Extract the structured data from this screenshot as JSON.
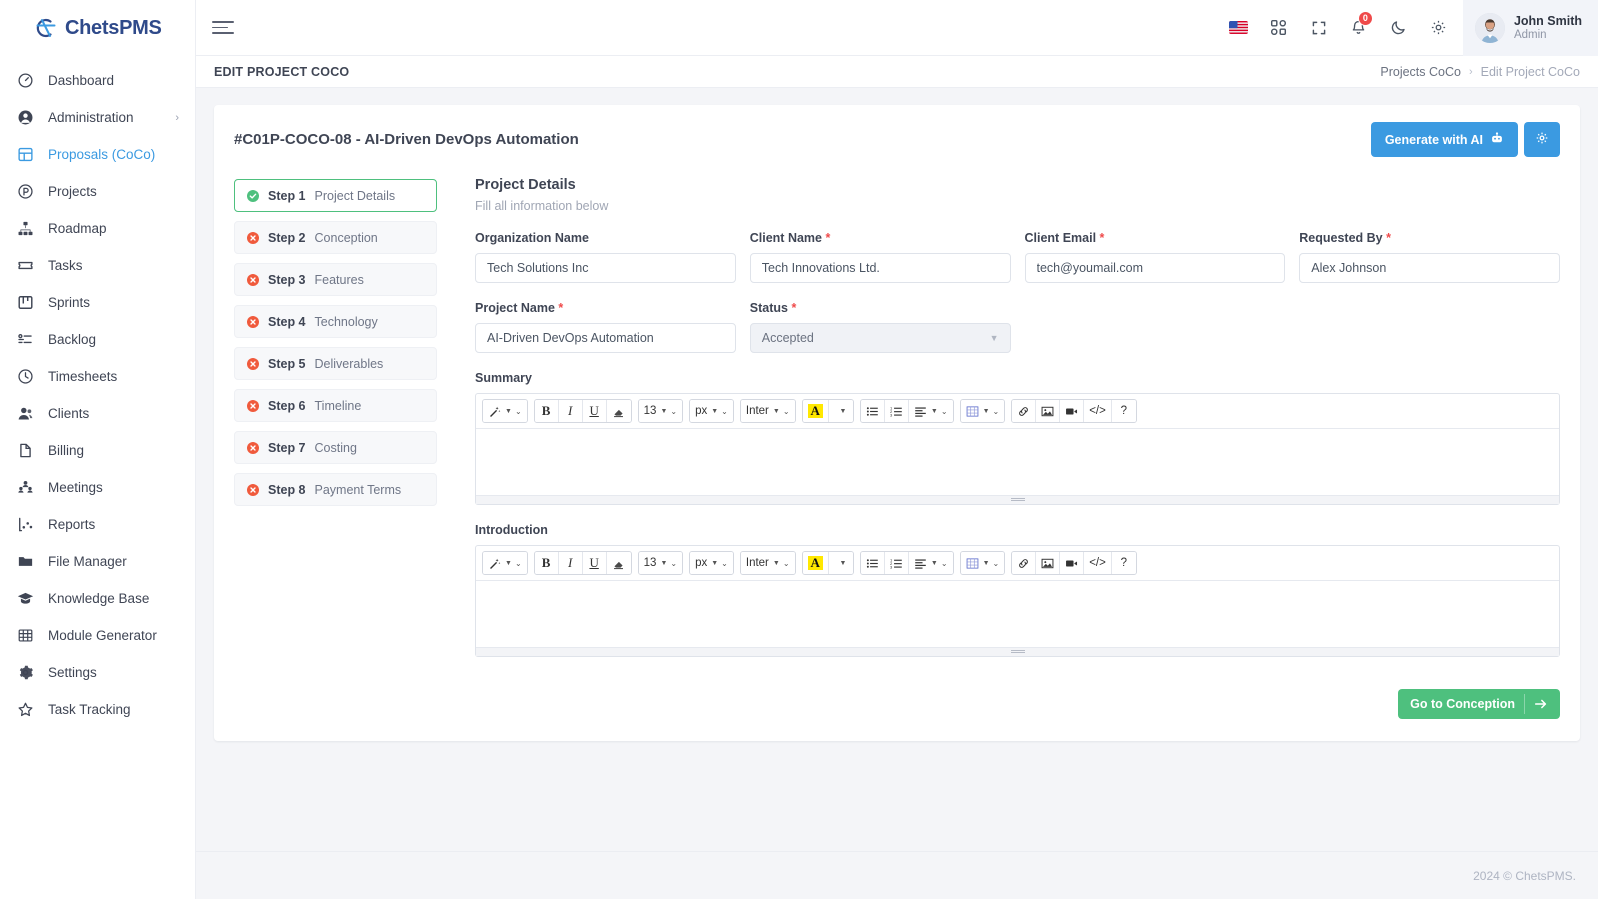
{
  "brand": {
    "name_part1": "Chets",
    "name_part2": "PMS",
    "logo_icon": "chets-logo-icon"
  },
  "sidebar": {
    "items": [
      {
        "label": "Dashboard",
        "icon": "gauge-icon",
        "active": false,
        "chevron": false
      },
      {
        "label": "Administration",
        "icon": "user-circle-icon",
        "active": false,
        "chevron": true
      },
      {
        "label": "Proposals (CoCo)",
        "icon": "layout-icon",
        "active": true,
        "chevron": false
      },
      {
        "label": "Projects",
        "icon": "p-circle-icon",
        "active": false,
        "chevron": false
      },
      {
        "label": "Roadmap",
        "icon": "hierarchy-icon",
        "active": false,
        "chevron": false
      },
      {
        "label": "Tasks",
        "icon": "ticket-icon",
        "active": false,
        "chevron": false
      },
      {
        "label": "Sprints",
        "icon": "kanban-icon",
        "active": false,
        "chevron": false
      },
      {
        "label": "Backlog",
        "icon": "list-check-icon",
        "active": false,
        "chevron": false
      },
      {
        "label": "Timesheets",
        "icon": "clock-icon",
        "active": false,
        "chevron": false
      },
      {
        "label": "Clients",
        "icon": "users-icon",
        "active": false,
        "chevron": false
      },
      {
        "label": "Billing",
        "icon": "file-icon",
        "active": false,
        "chevron": false
      },
      {
        "label": "Meetings",
        "icon": "people-group-icon",
        "active": false,
        "chevron": false
      },
      {
        "label": "Reports",
        "icon": "chart-icon",
        "active": false,
        "chevron": false
      },
      {
        "label": "File Manager",
        "icon": "folder-icon",
        "active": false,
        "chevron": false
      },
      {
        "label": "Knowledge Base",
        "icon": "graduation-cap-icon",
        "active": false,
        "chevron": false
      },
      {
        "label": "Module Generator",
        "icon": "grid-table-icon",
        "active": false,
        "chevron": false
      },
      {
        "label": "Settings",
        "icon": "gear-icon",
        "active": false,
        "chevron": false
      },
      {
        "label": "Task Tracking",
        "icon": "star-icon",
        "active": false,
        "chevron": false
      }
    ]
  },
  "topbar": {
    "menu_toggle_icon": "hamburger-icon",
    "icons": [
      {
        "name": "language-flag-icon",
        "label": "US"
      },
      {
        "name": "apps-grid-icon",
        "label": ""
      },
      {
        "name": "fullscreen-icon",
        "label": ""
      },
      {
        "name": "notifications-bell-icon",
        "label": ""
      },
      {
        "name": "dark-mode-moon-icon",
        "label": ""
      },
      {
        "name": "settings-gear-icon",
        "label": ""
      }
    ],
    "notification_count": "0",
    "user": {
      "name": "John Smith",
      "role": "Admin"
    }
  },
  "subbar": {
    "page_title": "EDIT PROJECT COCO",
    "breadcrumb": {
      "parent": "Projects CoCo",
      "separator": "›",
      "current": "Edit Project CoCo"
    }
  },
  "card": {
    "title": "#C01P-COCO-08 - AI-Driven DevOps Automation",
    "generate_button": "Generate with AI",
    "generate_icon": "robot-icon",
    "settings_icon": "gear-icon"
  },
  "steps": [
    {
      "num": "Step 1",
      "label": "Project Details",
      "state": "complete"
    },
    {
      "num": "Step 2",
      "label": "Conception",
      "state": "incomplete"
    },
    {
      "num": "Step 3",
      "label": "Features",
      "state": "incomplete"
    },
    {
      "num": "Step 4",
      "label": "Technology",
      "state": "incomplete"
    },
    {
      "num": "Step 5",
      "label": "Deliverables",
      "state": "incomplete"
    },
    {
      "num": "Step 6",
      "label": "Timeline",
      "state": "incomplete"
    },
    {
      "num": "Step 7",
      "label": "Costing",
      "state": "incomplete"
    },
    {
      "num": "Step 8",
      "label": "Payment Terms",
      "state": "incomplete"
    }
  ],
  "form": {
    "heading": "Project Details",
    "subheading": "Fill all information below",
    "organization_name": {
      "label": "Organization Name",
      "value": "Tech Solutions Inc",
      "required": false
    },
    "client_name": {
      "label": "Client Name",
      "value": "Tech Innovations Ltd.",
      "required": true
    },
    "client_email": {
      "label": "Client Email",
      "value": "tech@youmail.com",
      "required": true
    },
    "requested_by": {
      "label": "Requested By",
      "value": "Alex Johnson",
      "required": true
    },
    "project_name": {
      "label": "Project Name",
      "value": "AI-Driven DevOps Automation",
      "required": true
    },
    "status": {
      "label": "Status",
      "value": "Accepted",
      "required": true
    },
    "summary": {
      "label": "Summary",
      "value": ""
    },
    "introduction": {
      "label": "Introduction",
      "value": ""
    },
    "next_button": "Go to Conception",
    "next_icon": "arrow-right-icon"
  },
  "editor_toolbar": {
    "font_size": "13",
    "font_unit": "px",
    "font_family": "Inter",
    "buttons": [
      {
        "name": "magic-wand-icon",
        "label": ""
      },
      {
        "name": "bold-icon",
        "label": "B"
      },
      {
        "name": "italic-icon",
        "label": "I"
      },
      {
        "name": "underline-icon",
        "label": "U"
      },
      {
        "name": "clear-format-eraser-icon",
        "label": ""
      },
      {
        "name": "text-color-icon",
        "label": "A"
      },
      {
        "name": "bullet-list-icon",
        "label": ""
      },
      {
        "name": "ordered-list-icon",
        "label": ""
      },
      {
        "name": "align-icon",
        "label": ""
      },
      {
        "name": "table-icon",
        "label": ""
      },
      {
        "name": "link-icon",
        "label": ""
      },
      {
        "name": "image-icon",
        "label": ""
      },
      {
        "name": "video-icon",
        "label": ""
      },
      {
        "name": "code-view-icon",
        "label": "</>"
      },
      {
        "name": "help-icon",
        "label": "?"
      }
    ]
  },
  "footer": {
    "text": "2024 © ChetsPMS."
  },
  "colors": {
    "accent_blue": "#3b9ae1",
    "success_green": "#4ec07e",
    "danger_red": "#ef4a4a",
    "sidebar_active": "#3b9ae1"
  }
}
